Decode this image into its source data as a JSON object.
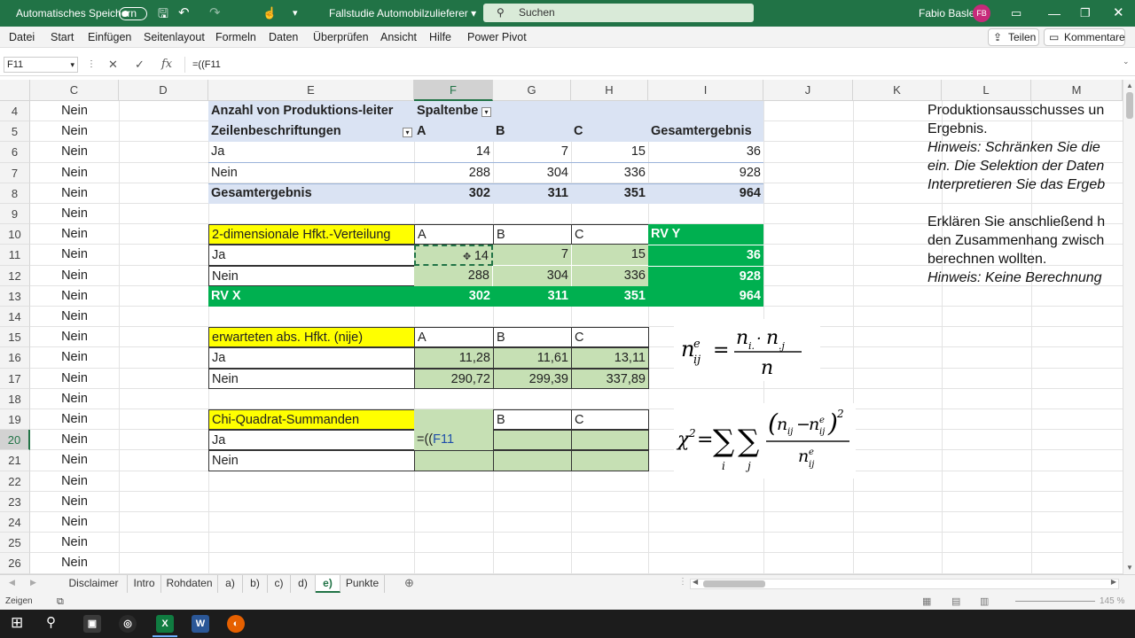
{
  "titlebar": {
    "autosave_label": "Automatisches Speichern",
    "file_title": "Fallstudie Automobilzulieferer",
    "search_placeholder": "Suchen",
    "user_name": "Fabio Basler",
    "user_initials": "FB"
  },
  "menu": {
    "items": [
      "Datei",
      "Start",
      "Einfügen",
      "Seitenlayout",
      "Formeln",
      "Daten",
      "Überprüfen",
      "Ansicht",
      "Hilfe",
      "Power Pivot"
    ],
    "share_label": "Teilen",
    "comments_label": "Kommentare"
  },
  "formula_bar": {
    "name_box": "F11",
    "formula": "=((F11"
  },
  "columns": [
    "C",
    "D",
    "E",
    "F",
    "G",
    "H",
    "I",
    "J",
    "K",
    "L",
    "M"
  ],
  "rows": [
    "4",
    "5",
    "6",
    "7",
    "8",
    "9",
    "10",
    "11",
    "12",
    "13",
    "14",
    "15",
    "16",
    "17",
    "18",
    "19",
    "20",
    "21",
    "22",
    "23",
    "24",
    "25",
    "26"
  ],
  "column_c": [
    "Nein",
    "Nein",
    "Nein",
    "Nein",
    "Nein",
    "Nein",
    "Nein",
    "Nein",
    "Nein",
    "Nein",
    "Nein",
    "Nein",
    "Nein",
    "Nein",
    "Nein",
    "Nein",
    "Nein",
    "Nein",
    "Nein",
    "Nein",
    "Nein",
    "Nein",
    "Nein"
  ],
  "pivot": {
    "title": "Anzahl von Produktions-leiter",
    "col_label": "Spaltenbe",
    "row_label": "Zeilenbeschriftungen",
    "headers": [
      "A",
      "B",
      "C",
      "Gesamtergebnis"
    ],
    "rows": [
      {
        "label": "Ja",
        "values": [
          "14",
          "7",
          "15",
          "36"
        ]
      },
      {
        "label": "Nein",
        "values": [
          "288",
          "304",
          "336",
          "928"
        ]
      }
    ],
    "total": {
      "label": "Gesamtergebnis",
      "values": [
        "302",
        "311",
        "351",
        "964"
      ]
    }
  },
  "table2d": {
    "title": "2-dimensionale Hfkt.-Verteilung",
    "headers": [
      "A",
      "B",
      "C",
      "RV Y"
    ],
    "rows": [
      {
        "label": "Ja",
        "values": [
          "14",
          "7",
          "15",
          "36"
        ]
      },
      {
        "label": "Nein",
        "values": [
          "288",
          "304",
          "336",
          "928"
        ]
      }
    ],
    "total": {
      "label": "RV X",
      "values": [
        "302",
        "311",
        "351",
        "964"
      ]
    }
  },
  "expected": {
    "title": "erwarteten abs. Hfkt. (nije)",
    "headers": [
      "A",
      "B",
      "C"
    ],
    "rows": [
      {
        "label": "Ja",
        "values": [
          "11,28",
          "11,61",
          "13,11"
        ]
      },
      {
        "label": "Nein",
        "values": [
          "290,72",
          "299,39",
          "337,89"
        ]
      }
    ]
  },
  "chi": {
    "title": "Chi-Quadrat-Summanden",
    "headers": [
      "",
      "B",
      "C"
    ],
    "rows": [
      {
        "label": "Ja",
        "values": [
          "=((F11",
          "",
          ""
        ]
      },
      {
        "label": "Nein",
        "values": [
          "",
          "",
          ""
        ]
      }
    ]
  },
  "right_text": [
    "Produktionsausschusses un",
    "Ergebnis.",
    "Hinweis: Schränken Sie die",
    "ein. Die Selektion der Daten",
    "Interpretieren Sie das Ergeb",
    "",
    "Erklären Sie anschließend h",
    "den Zusammenhang zwisch",
    "berechnen wollten.",
    "Hinweis: Keine Berechnung"
  ],
  "sheets": [
    "Disclaimer",
    "Intro",
    "Rohdaten",
    "a)",
    "b)",
    "c)",
    "d)",
    "e)",
    "Punkte"
  ],
  "active_sheet": "e)",
  "status": {
    "mode": "Zeigen",
    "zoom": "145 %"
  },
  "colors": {
    "excel_green": "#217346",
    "yellow": "#ffff00",
    "dark_green": "#00b050",
    "light_green": "#c6e0b4",
    "pivot_blue": "#dae3f3"
  }
}
